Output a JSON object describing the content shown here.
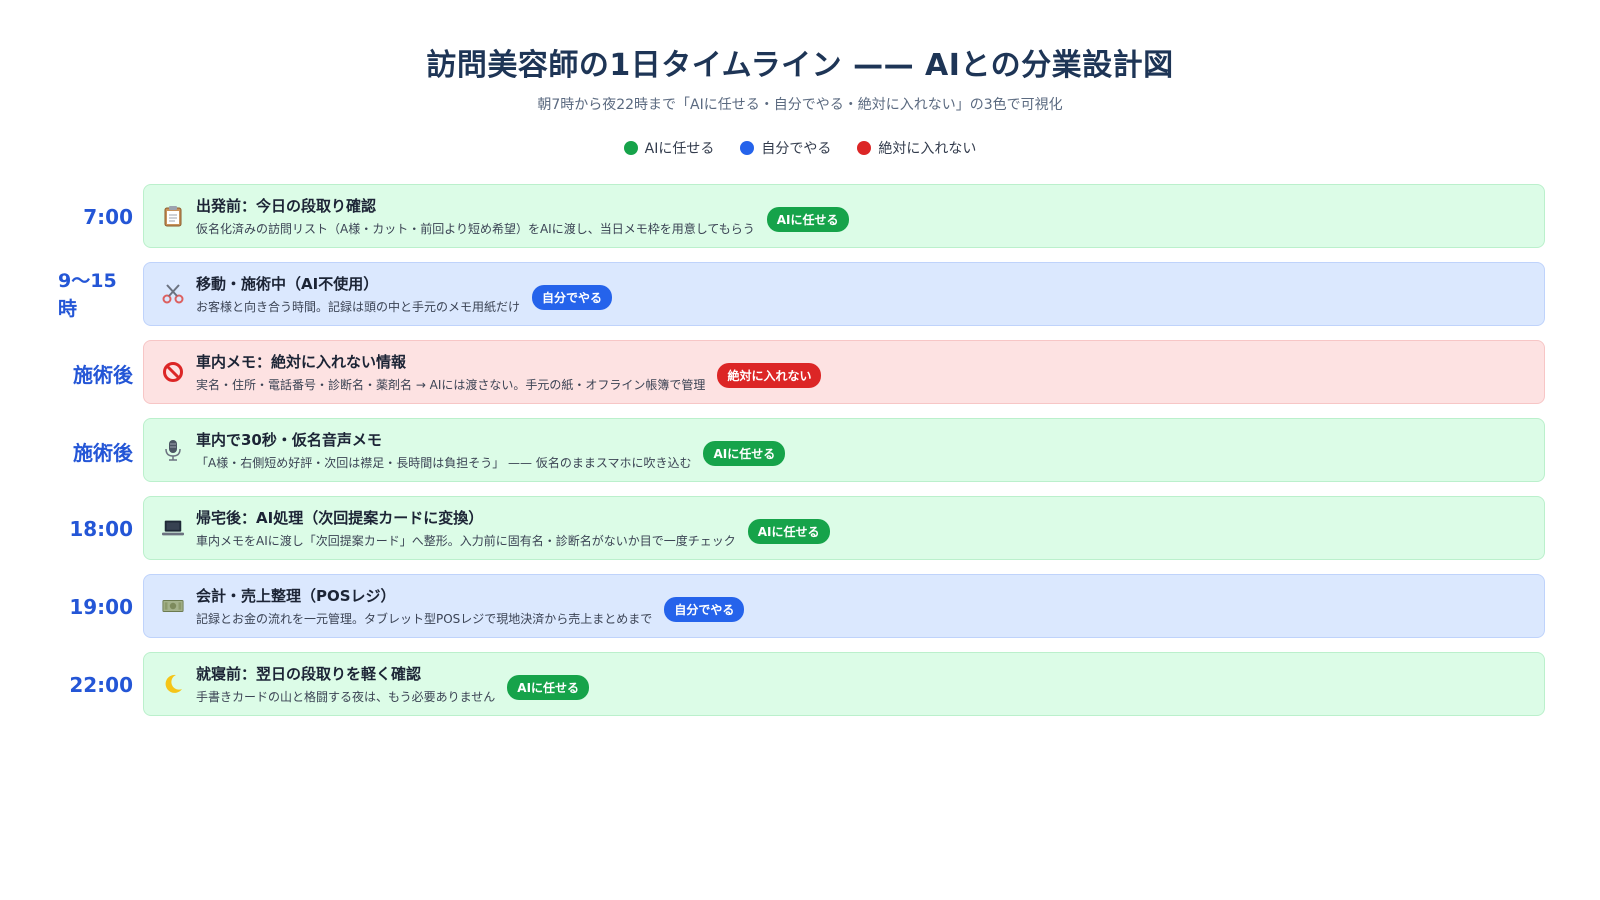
{
  "title": "訪問美容師の1日タイムライン —— AIとの分業設計図",
  "subtitle": "朝7時から夜22時まで「AIに任せる・自分でやる・絶対に入れない」の3色で可視化",
  "legend": [
    {
      "label": "AIに任せる",
      "color": "#16a34a"
    },
    {
      "label": "自分でやる",
      "color": "#2563eb"
    },
    {
      "label": "絶対に入れない",
      "color": "#dc2626"
    }
  ],
  "rows": [
    {
      "time": "7:00",
      "icon": "clipboard-icon",
      "title": "出発前：今日の段取り確認",
      "desc": "仮名化済みの訪問リスト（A様・カット・前回より短め希望）をAIに渡し、当日メモ枠を用意してもらう",
      "badge": "AIに任せる",
      "category": "ai"
    },
    {
      "time": "9〜15時",
      "icon": "scissors-icon",
      "title": "移動・施術中（AI不使用）",
      "desc": "お客様と向き合う時間。記録は頭の中と手元のメモ用紙だけ",
      "badge": "自分でやる",
      "category": "self"
    },
    {
      "time": "施術後",
      "icon": "prohibited-icon",
      "title": "車内メモ：絶対に入れない情報",
      "desc": "実名・住所・電話番号・診断名・薬剤名 → AIには渡さない。手元の紙・オフライン帳簿で管理",
      "badge": "絶対に入れない",
      "category": "never"
    },
    {
      "time": "施術後",
      "icon": "microphone-icon",
      "title": "車内で30秒・仮名音声メモ",
      "desc": "「A様・右側短め好評・次回は襟足・長時間は負担そう」 —— 仮名のままスマホに吹き込む",
      "badge": "AIに任せる",
      "category": "ai"
    },
    {
      "time": "18:00",
      "icon": "laptop-icon",
      "title": "帰宅後：AI処理（次回提案カードに変換）",
      "desc": "車内メモをAIに渡し「次回提案カード」へ整形。入力前に固有名・診断名がないか目で一度チェック",
      "badge": "AIに任せる",
      "category": "ai"
    },
    {
      "time": "19:00",
      "icon": "money-icon",
      "title": "会計・売上整理（POSレジ）",
      "desc": "記録とお金の流れを一元管理。タブレット型POSレジで現地決済から売上まとめまで",
      "badge": "自分でやる",
      "category": "self"
    },
    {
      "time": "22:00",
      "icon": "moon-icon",
      "title": "就寝前：翌日の段取りを軽く確認",
      "desc": "手書きカードの山と格闘する夜は、もう必要ありません",
      "badge": "AIに任せる",
      "category": "ai"
    }
  ]
}
